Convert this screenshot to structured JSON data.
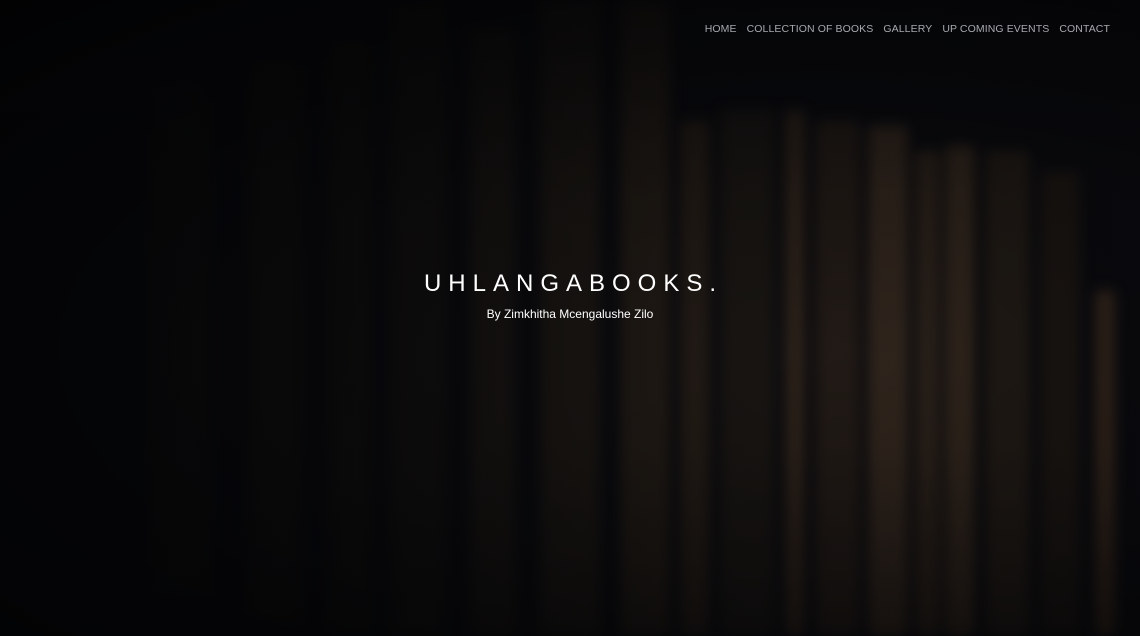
{
  "nav": {
    "items": [
      {
        "label": "HOME"
      },
      {
        "label": "COLLECTION OF BOOKS"
      },
      {
        "label": "GALLERY"
      },
      {
        "label": "UP COMING EVENTS"
      },
      {
        "label": "CONTACT"
      }
    ]
  },
  "hero": {
    "title": "UHLANGABOOKS.",
    "subtitle": "By Zimkhitha Mcengalushe Zilo"
  },
  "colors": {
    "background": "#0b0c10",
    "nav_text": "#a7a9ad",
    "title_text": "#ffffff"
  }
}
